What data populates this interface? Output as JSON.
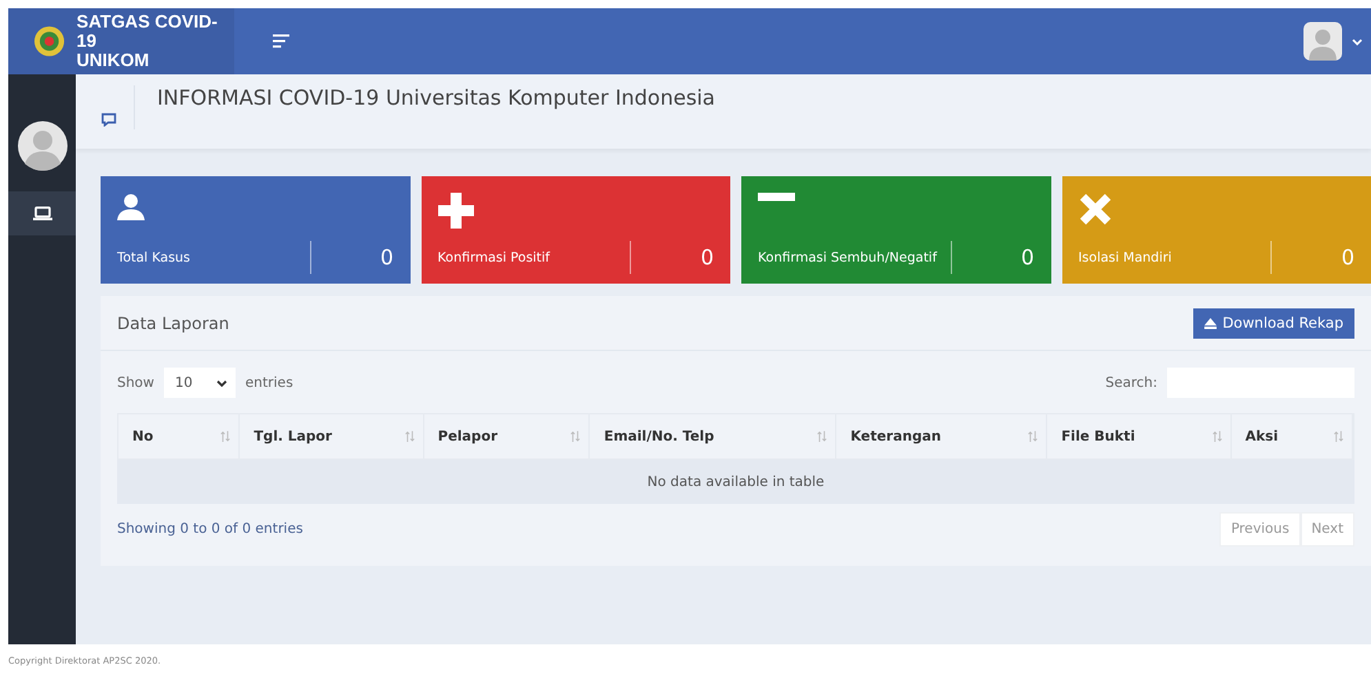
{
  "brand": {
    "line1": "SATGAS COVID-19",
    "line2": "UNIKOM"
  },
  "page_title": "INFORMASI COVID-19 Universitas Komputer Indonesia",
  "stats": [
    {
      "kind": "person",
      "label": "Total Kasus",
      "value": "0",
      "color": "#4266b3"
    },
    {
      "kind": "plus",
      "label": "Konfirmasi Positif",
      "value": "0",
      "color": "#dc3234"
    },
    {
      "kind": "minus",
      "label": "Konfirmasi Sembuh/Negatif",
      "value": "0",
      "color": "#218a34"
    },
    {
      "kind": "times",
      "label": "Isolasi Mandiri",
      "value": "0",
      "color": "#d59b16"
    }
  ],
  "panel": {
    "title": "Data Laporan",
    "download_button": "Download Rekap"
  },
  "length": {
    "prefix": "Show",
    "value": "10",
    "suffix": "entries"
  },
  "search": {
    "label": "Search:"
  },
  "table": {
    "columns": [
      "No",
      "Tgl. Lapor",
      "Pelapor",
      "Email/No. Telp",
      "Keterangan",
      "File Bukti",
      "Aksi"
    ],
    "empty": "No data available in table"
  },
  "info": "Showing 0 to 0 of 0 entries",
  "pagination": [
    {
      "label": "Previous",
      "disabled": true
    },
    {
      "label": "Next",
      "disabled": true
    }
  ],
  "footer": "Copyright Direktorat AP2SC 2020."
}
